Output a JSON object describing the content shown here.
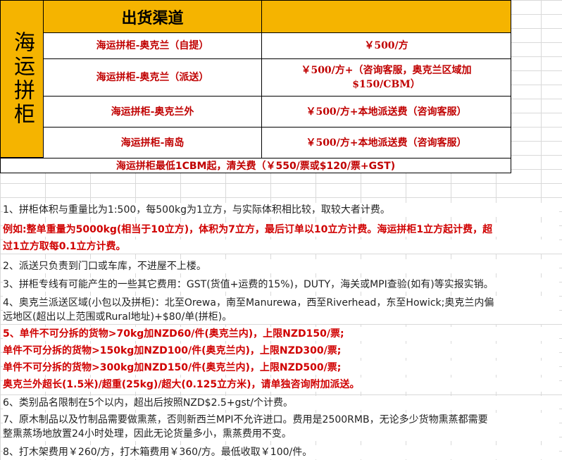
{
  "table": {
    "side_label": "海运拼柜",
    "header": "出货渠道",
    "rows": [
      {
        "channel": "海运拼柜-奥克兰（自提）",
        "price": "￥500/方"
      },
      {
        "channel": "海运拼柜-奥克兰（派送）",
        "price_line1": "￥500/方+（咨询客服，奥克兰区域加",
        "price_line2": "$150/CBM）"
      },
      {
        "channel": "海运拼柜-奥克兰外",
        "price": "￥500/方+本地派送费（咨询客服）"
      },
      {
        "channel": "海运拼柜-南岛",
        "price": "￥500/方+本地派送费（咨询客服）"
      }
    ],
    "footer": "海运拼柜最低1CBM起，清关费（￥550/票或$120/票+GST)"
  },
  "notes": [
    {
      "text": "1、拼柜体积与重量比为1:500，每500kg为1立方，与实际体积相比较，取较大者计费。",
      "red": false
    },
    {
      "text": "例如:整单重量为5000kg(相当于10立方)，体积为7立方，最后订单以10立方计费。海运拼柜1立方起计费，超",
      "red": true
    },
    {
      "text": "过1立方取每0.1立方计费。",
      "red": true
    },
    {
      "text": "2、派送只负责到门口或车库，不进屋不上楼。",
      "red": false
    },
    {
      "text": "3、拼柜专线有可能产生的一些其它费用：GST(货值+运费的15%)，DUTY，海关或MPI查验(如有)等实报实销。",
      "red": false
    },
    {
      "text": "4、奥克兰派送区域(小包以及拼柜)：北至Orewa，南至Manurewa，西至Riverhead，东至Howick;奥克兰内偏",
      "red": false
    },
    {
      "text": "远地区(超出以上范围或Rural地址)+$80/单(拼柜)。",
      "red": false
    },
    {
      "text": "5、单件不可分拆的货物>70kg加NZD60/件(奥克兰内)，上限NZD150/票;",
      "red": true
    },
    {
      "text": "单件不可分拆的货物>150kg加NZD100/件(奥克兰内)，上限NZD300/票;",
      "red": true
    },
    {
      "text": "单件不可分拆的货物>300kg加NZD150/件(奥克兰内)，上限NZD500/票;",
      "red": true
    },
    {
      "text": "奥克兰外超长(1.5米)/超重(25kg)/超大(0.125立方米)，请单独咨询附加派送。",
      "red": true
    },
    {
      "text": "6、类别品名限制在5个以内，超出后按照NZD$2.5+gst/个计费。",
      "red": false
    },
    {
      "text": "7、原木制品以及竹制品需要做熏蒸，否则新西兰MPI不允许进口。费用是2500RMB，无论多少货物熏蒸都需要",
      "red": false
    },
    {
      "text": "整熏蒸场地放置24小时处理，因此无论货量多小，熏蒸费用不变。",
      "red": false
    },
    {
      "text": "8、打木架费用￥260/方，打木箱费用￥360/方。最低收取￥100/件。",
      "red": false
    }
  ]
}
